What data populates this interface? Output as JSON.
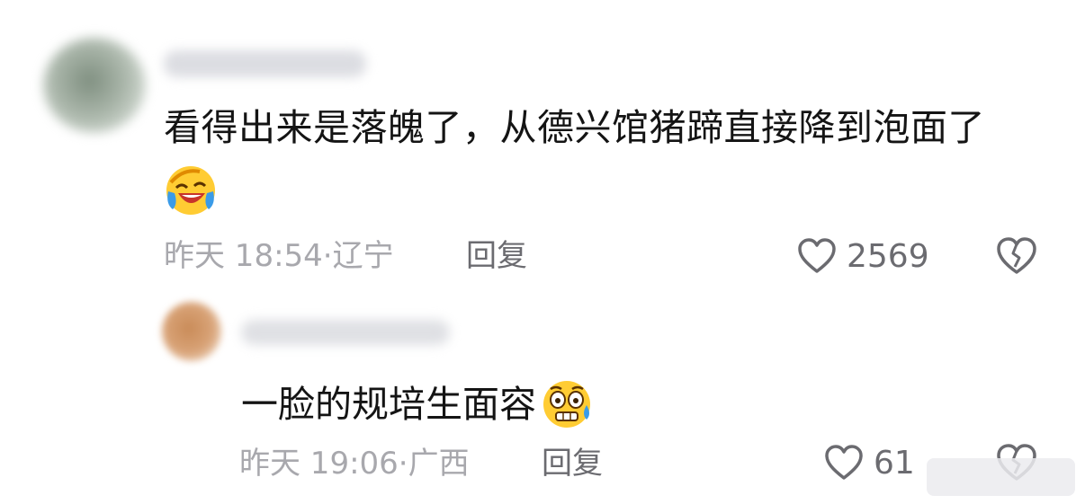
{
  "comments": [
    {
      "text": "看得出来是落魄了，从德兴馆猪蹄直接降到泡面了",
      "emoji": "laughing-crying-emoji",
      "time": "昨天 18:54",
      "separator": "·",
      "location": "辽宁",
      "reply_label": "回复",
      "like_count": "2569",
      "like_icon": "heart-outline-icon",
      "dislike_icon": "broken-heart-icon"
    },
    {
      "text": "一脸的规培生面容",
      "emoji": "nervous-sweat-emoji",
      "time": "昨天 19:06",
      "separator": "·",
      "location": "广西",
      "reply_label": "回复",
      "like_count": "61",
      "like_icon": "heart-outline-icon",
      "dislike_icon": "broken-heart-icon"
    }
  ],
  "colors": {
    "text_primary": "#141414",
    "text_meta": "#a8a8ad",
    "text_action": "#6b6b70"
  }
}
